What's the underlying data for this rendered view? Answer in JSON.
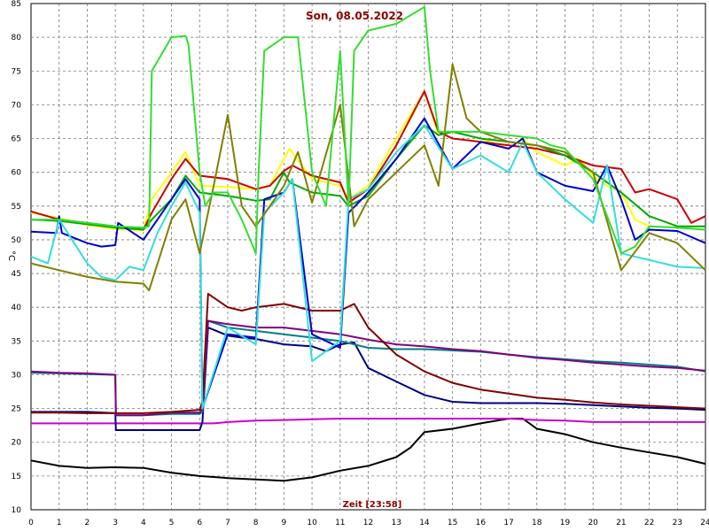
{
  "chart_data": {
    "type": "line",
    "title": "Son, 08.05.2022",
    "xlabel": "Zeit [23:58]",
    "ylabel": "°C",
    "xlim": [
      0,
      24
    ],
    "ylim": [
      10,
      85
    ],
    "x_ticks": [
      "0",
      "1",
      "2",
      "3",
      "4",
      "5",
      "6",
      "7",
      "8",
      "9",
      "10",
      "11",
      "12",
      "13",
      "14",
      "15",
      "16",
      "17",
      "18",
      "19",
      "20",
      "21",
      "22",
      "23",
      "24"
    ],
    "y_ticks": [
      "10",
      "15",
      "20",
      "25",
      "30",
      "35",
      "40",
      "45",
      "50",
      "55",
      "60",
      "65",
      "70",
      "75",
      "80",
      "85"
    ],
    "grid": true,
    "title_color": "#8b0000",
    "series": [
      {
        "color": "#000000",
        "x": [
          0,
          1,
          2,
          3,
          4,
          5,
          6,
          7,
          8,
          9,
          10,
          11,
          12,
          13,
          13.5,
          14,
          15,
          16,
          17,
          17.5,
          18,
          19,
          20,
          21,
          22,
          23,
          24
        ],
        "y": [
          17.3,
          16.5,
          16.2,
          16.3,
          16.2,
          15.5,
          15,
          14.7,
          14.5,
          14.3,
          14.8,
          15.8,
          16.5,
          17.8,
          19.2,
          21.5,
          22,
          22.8,
          23.5,
          23.5,
          22,
          21.2,
          20,
          19.2,
          18.5,
          17.8,
          16.8
        ]
      },
      {
        "color": "#cc00cc",
        "x": [
          0,
          1,
          2,
          3,
          4,
          5,
          6,
          6.5,
          7,
          8,
          9,
          10,
          11,
          12,
          13,
          14,
          15,
          16,
          17,
          18,
          19,
          20,
          21,
          22,
          23,
          24
        ],
        "y": [
          22.8,
          22.8,
          22.8,
          22.8,
          22.8,
          22.8,
          22.8,
          22.8,
          23,
          23.2,
          23.3,
          23.4,
          23.5,
          23.5,
          23.5,
          23.5,
          23.5,
          23.5,
          23.5,
          23.3,
          23.2,
          23,
          23,
          23,
          23,
          23
        ]
      },
      {
        "color": "#000080",
        "x": [
          0,
          1,
          2,
          3,
          3.02,
          4,
          5,
          6,
          6.1,
          6.3,
          7,
          7.5,
          8,
          9,
          10,
          10.5,
          11,
          11.5,
          12,
          13,
          14,
          15,
          16,
          17,
          18,
          19,
          20,
          21,
          22,
          23,
          24
        ],
        "y": [
          24.5,
          24.5,
          24.5,
          24.3,
          21.8,
          21.8,
          21.8,
          21.8,
          23,
          37,
          35.8,
          35.5,
          35.3,
          34.5,
          34.2,
          33.5,
          34.5,
          34.8,
          31,
          29,
          27,
          26,
          25.8,
          25.8,
          25.8,
          25.7,
          25.5,
          25.3,
          25.1,
          25,
          24.8
        ]
      },
      {
        "color": "#008080",
        "x": [
          0,
          1,
          2,
          3,
          3.02,
          4,
          5,
          6,
          6.1,
          6.3,
          7,
          8,
          9,
          10,
          11,
          12,
          13,
          14,
          15,
          16,
          17,
          18,
          19,
          20,
          21,
          22,
          23,
          24
        ],
        "y": [
          30.3,
          30.2,
          30.1,
          30,
          24,
          24,
          24.2,
          24.2,
          24.5,
          38,
          37,
          36.5,
          36,
          35.5,
          35,
          34,
          33.8,
          33.8,
          33.6,
          33.4,
          33,
          32.6,
          32.3,
          32,
          31.8,
          31.5,
          31.2,
          30.5
        ]
      },
      {
        "color": "#800080",
        "x": [
          0,
          1,
          2,
          3,
          3.02,
          4,
          5,
          6,
          6.1,
          6.3,
          7,
          8,
          9,
          10,
          11,
          12,
          13,
          14,
          15,
          16,
          17,
          18,
          19,
          20,
          21,
          22,
          23,
          24
        ],
        "y": [
          30.5,
          30.3,
          30.2,
          30,
          24,
          24,
          24.4,
          24.4,
          25,
          38,
          37.5,
          37,
          37,
          36.5,
          36,
          35.2,
          34.5,
          34.2,
          33.8,
          33.5,
          33,
          32.5,
          32.2,
          31.8,
          31.5,
          31.2,
          31,
          30.6
        ]
      },
      {
        "color": "#800000",
        "x": [
          0,
          1,
          2,
          3,
          4,
          5,
          6,
          6.1,
          6.3,
          7,
          7.5,
          8,
          9,
          10,
          11,
          11.5,
          12,
          13,
          14,
          15,
          16,
          17,
          18,
          19,
          20,
          21,
          22,
          23,
          24
        ],
        "y": [
          24.4,
          24.4,
          24.3,
          24.3,
          24.3,
          24.5,
          24.8,
          26,
          42,
          40,
          39.5,
          40,
          40.5,
          39.5,
          39.5,
          40.5,
          37,
          33,
          30.5,
          28.8,
          27.8,
          27.2,
          26.6,
          26.3,
          25.9,
          25.6,
          25.4,
          25.2,
          25
        ]
      },
      {
        "color": "#ffff00",
        "x": [
          0,
          1,
          2,
          3,
          4,
          4.3,
          5,
          5.5,
          6,
          7,
          8,
          8.5,
          9,
          9.2,
          10,
          11,
          11.3,
          12,
          13,
          14,
          14.5,
          15,
          16,
          17,
          17.5,
          18,
          19,
          19.5,
          20,
          20.5,
          21,
          21.5,
          22,
          23,
          24
        ],
        "y": [
          54,
          53.2,
          52.2,
          51.6,
          51.4,
          56,
          60,
          63,
          58,
          57.8,
          57.5,
          58,
          62,
          63.5,
          59,
          58,
          56,
          58,
          65,
          72,
          65.5,
          66,
          65,
          63.5,
          65,
          63,
          61,
          62,
          59.5,
          58,
          57,
          53,
          52,
          51.8,
          51.5
        ]
      },
      {
        "color": "#cc0000",
        "x": [
          0,
          1,
          2,
          3,
          4,
          4.3,
          5,
          5.5,
          6,
          7,
          8,
          8.5,
          9,
          9.3,
          10,
          11,
          11.3,
          12,
          13,
          14,
          14.5,
          15,
          16,
          17,
          18,
          19,
          20,
          21,
          21.5,
          22,
          23,
          23.5,
          24
        ],
        "y": [
          54.2,
          53,
          52.5,
          52,
          51.5,
          54,
          59,
          62,
          59.5,
          59,
          57.5,
          58,
          60.2,
          61,
          59.5,
          58.5,
          55.5,
          57.5,
          64,
          72,
          66,
          65,
          64.5,
          64,
          63.5,
          62.5,
          61,
          60.5,
          57,
          57.5,
          56,
          52.5,
          53.5
        ]
      },
      {
        "color": "#00aa00",
        "x": [
          0,
          1,
          2,
          3,
          4,
          4.3,
          5,
          5.5,
          6,
          7,
          8,
          8.5,
          9,
          9.2,
          10,
          11,
          11.3,
          12,
          13,
          14,
          14.5,
          15,
          16,
          17,
          18,
          19,
          20,
          21,
          22,
          23,
          24
        ],
        "y": [
          53,
          52.8,
          52.3,
          51.8,
          51.5,
          53,
          56,
          59.5,
          57,
          56.5,
          55.8,
          56,
          60,
          58.5,
          57,
          56.5,
          55,
          56.5,
          62,
          67,
          65.5,
          66,
          65,
          64.5,
          64,
          62.5,
          60,
          57,
          53.5,
          52,
          52
        ]
      },
      {
        "color": "#0000cc",
        "x": [
          0,
          0.9,
          1,
          1.1,
          2,
          2.5,
          3,
          3.1,
          4,
          4.5,
          5,
          5.5,
          6,
          6.1,
          7,
          8,
          8.3,
          9,
          9.3,
          10,
          11,
          11.3,
          12,
          13,
          14,
          15,
          16,
          17,
          17.5,
          18,
          19,
          20,
          20.5,
          21,
          21.5,
          22,
          23,
          24
        ],
        "y": [
          51.2,
          51,
          53.5,
          51,
          49.5,
          49,
          49.2,
          52.5,
          50,
          53,
          56,
          59,
          56,
          25,
          36,
          35.5,
          56,
          57,
          59,
          36,
          34,
          54,
          57,
          62,
          68,
          60.5,
          64.5,
          63.5,
          65,
          60,
          58,
          57.2,
          61,
          56,
          50,
          51.5,
          51.3,
          49.5
        ]
      },
      {
        "color": "#33dddd",
        "x": [
          0,
          0.6,
          1,
          2,
          2.5,
          3,
          3.5,
          4,
          4.5,
          5,
          5.5,
          6,
          6.1,
          7,
          8,
          8.3,
          9,
          9.3,
          10,
          11,
          11.3,
          12,
          13,
          14,
          15,
          16,
          17,
          17.5,
          18,
          19,
          20,
          20.5,
          21,
          22,
          23,
          24
        ],
        "y": [
          47.5,
          46.5,
          53,
          46.5,
          44.5,
          44,
          46,
          45.5,
          51,
          55,
          58.5,
          54,
          25,
          37,
          34.5,
          54,
          57,
          59,
          32,
          35,
          56,
          57.5,
          63,
          67,
          60.5,
          62.5,
          60,
          64.5,
          60,
          56,
          52.5,
          61,
          48,
          47,
          46,
          45.8
        ]
      },
      {
        "color": "#808000",
        "x": [
          0,
          1,
          2,
          3,
          4,
          4.2,
          5,
          5.5,
          6,
          6.5,
          7,
          7.5,
          8,
          9,
          9.5,
          10,
          11,
          11.5,
          12,
          13,
          14,
          14.5,
          15,
          15.5,
          16,
          17,
          18,
          19,
          20,
          21,
          22,
          23,
          24
        ],
        "y": [
          46.5,
          45.5,
          44.5,
          43.8,
          43.5,
          42.5,
          53,
          56,
          48,
          58,
          68.5,
          55,
          52,
          58,
          63,
          55.5,
          70,
          52,
          56,
          60,
          64,
          58,
          76,
          68,
          66,
          64.5,
          64,
          63,
          60,
          45.5,
          51,
          49.5,
          45.5
        ]
      },
      {
        "color": "#33dd33",
        "x": [
          0,
          1,
          2,
          3,
          4,
          4.2,
          4.3,
          5,
          5.5,
          5.6,
          6,
          6.2,
          6.5,
          7,
          7.5,
          8,
          8.1,
          8.3,
          9,
          9.5,
          10,
          10.5,
          11,
          11.3,
          11.5,
          12,
          13,
          14,
          14.2,
          14.5,
          15,
          16,
          17,
          18,
          18.5,
          19,
          20,
          21,
          21.5,
          22,
          23,
          24
        ],
        "y": [
          53,
          53,
          52.5,
          52,
          51.8,
          52,
          75,
          80,
          80.2,
          79,
          60,
          55,
          57,
          57,
          53,
          48,
          60,
          78,
          80,
          80,
          60,
          55,
          78,
          55,
          78,
          81,
          82,
          84.5,
          75,
          66,
          66,
          66,
          65.5,
          65,
          64,
          63.5,
          59,
          48,
          49,
          52,
          51.8,
          51.5
        ]
      }
    ]
  }
}
